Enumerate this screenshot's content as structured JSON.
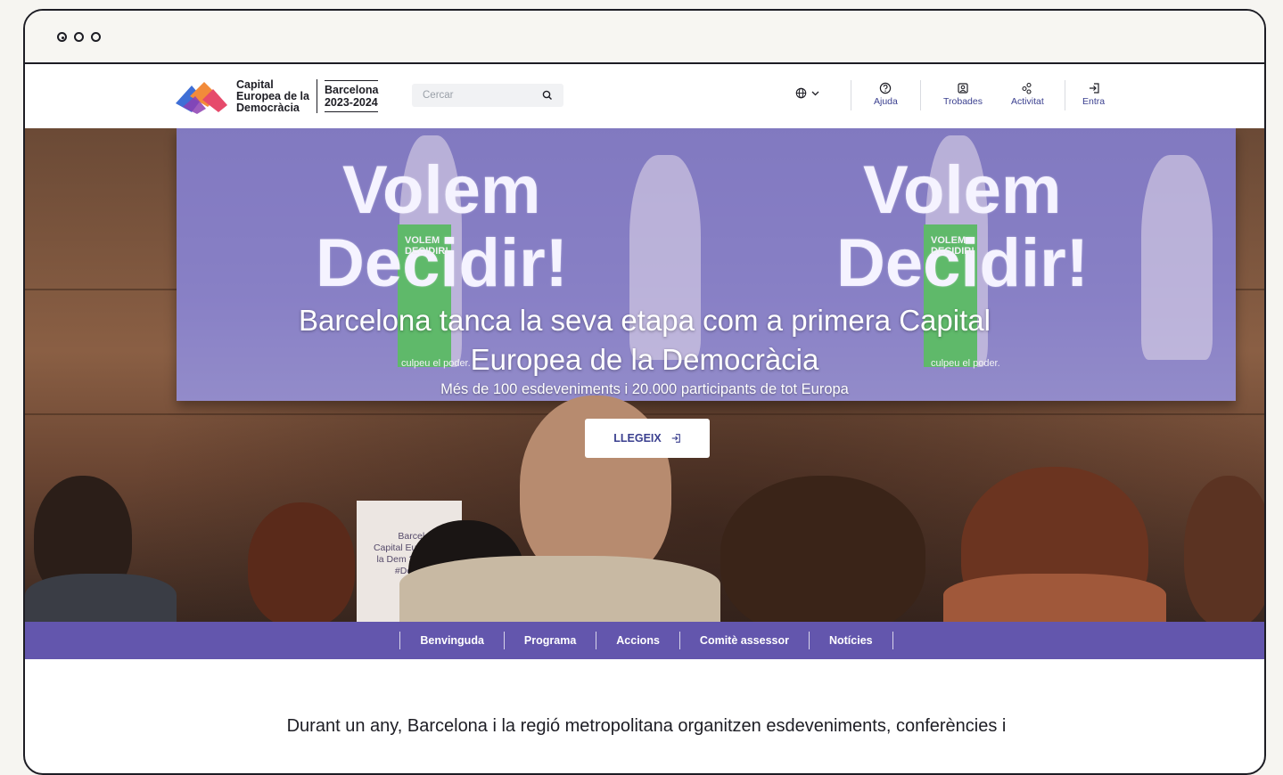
{
  "window": {
    "controls": [
      "window-dot-1",
      "window-dot-2",
      "window-dot-3"
    ]
  },
  "logo": {
    "line1": "Capital",
    "line2": "Europea de la",
    "line3": "Democràcia",
    "city": "Barcelona",
    "years": "2023-2024"
  },
  "search": {
    "placeholder": "Cercar"
  },
  "header": {
    "language_icon": "globe-icon",
    "items": [
      {
        "label": "Ajuda",
        "icon": "help-icon"
      },
      {
        "label": "Trobades",
        "icon": "meetings-icon"
      },
      {
        "label": "Activitat",
        "icon": "activity-icon"
      },
      {
        "label": "Entra",
        "icon": "login-icon"
      }
    ]
  },
  "hero": {
    "screen_text_line1": "Volem",
    "screen_text_line2": "Decidir!",
    "screen_small_text": "culpeu el poder.",
    "placard_text": "VOLEM DECIDIR!",
    "title_line1": "Barcelona tanca la seva etapa com a primera Capital",
    "title_line2": "Europea de la Democràcia",
    "subtitle": "Més de 100 esdeveniments i 20.000 participants de tot Europa",
    "button_label": "LLEGEIX",
    "rollup_text": "Barcelo Capital Eu de la Dem 2023 #Democ"
  },
  "tabs": [
    "Benvinguda",
    "Programa",
    "Accions",
    "Comitè assessor",
    "Notícies"
  ],
  "intro": "Durant un any, Barcelona i la regió metropolitana organitzen esdeveniments, conferències i",
  "colors": {
    "brand_purple": "#6356ad",
    "link_blue": "#3a3f8f",
    "frame": "#1d1d24"
  }
}
